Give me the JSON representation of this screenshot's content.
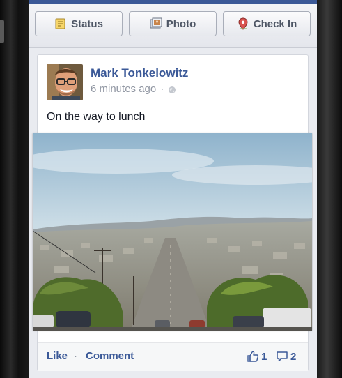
{
  "publisher": {
    "status_label": "Status",
    "photo_label": "Photo",
    "checkin_label": "Check In"
  },
  "post": {
    "author": "Mark Tonkelowitz",
    "time": "6 minutes ago",
    "separator": "·",
    "message": "On the way to lunch",
    "like_label": "Like",
    "comment_label": "Comment",
    "action_separator": "·",
    "like_count": "1",
    "comment_count": "2"
  },
  "colors": {
    "brand": "#3b5998",
    "meta_gray": "#9197a3",
    "screen_bg": "#e9ebf0"
  },
  "icons": {
    "status": "status-note-icon",
    "photo": "photo-icon",
    "checkin": "location-pin-icon",
    "privacy": "globe-icon",
    "like": "thumbs-up-icon",
    "comment": "comment-bubble-icon"
  }
}
